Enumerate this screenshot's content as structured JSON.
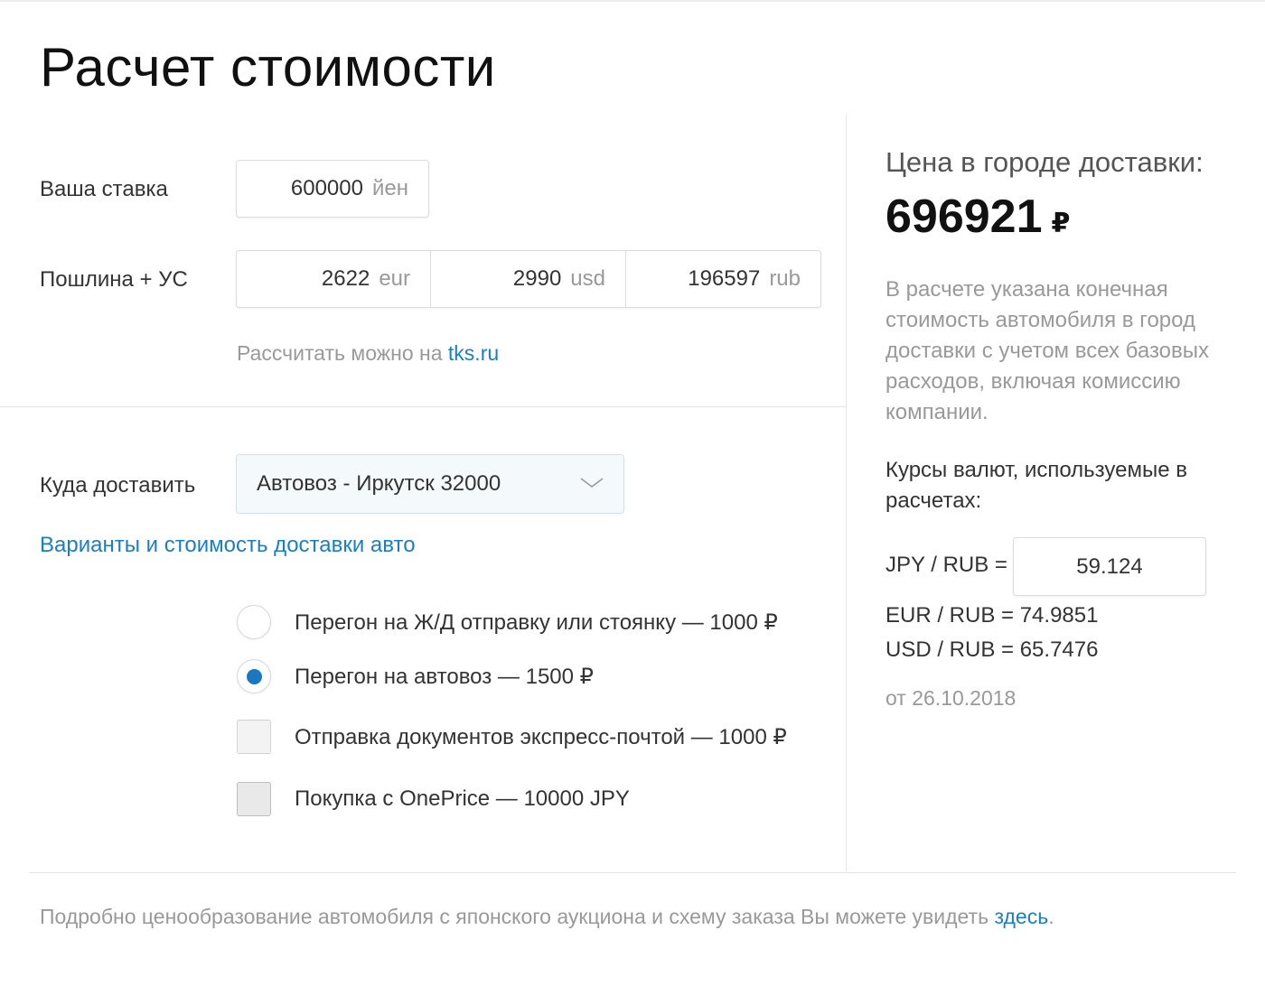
{
  "title": "Расчет стоимости",
  "bid": {
    "label": "Ваша ставка",
    "value": "600000",
    "unit": "йен"
  },
  "duty": {
    "label": "Пошлина + УС",
    "fields": [
      {
        "value": "2622",
        "unit": "eur"
      },
      {
        "value": "2990",
        "unit": "usd"
      },
      {
        "value": "196597",
        "unit": "rub"
      }
    ],
    "hint_text": "Рассчитать можно на",
    "hint_link": "tks.ru"
  },
  "delivery": {
    "label": "Куда доставить",
    "selected": "Автовоз - Иркутск 32000",
    "link": "Варианты и стоимость доставки авто"
  },
  "options": [
    {
      "type": "radio",
      "checked": false,
      "label": "Перегон на Ж/Д отправку или стоянку — 1000 ₽"
    },
    {
      "type": "radio",
      "checked": true,
      "label": "Перегон на автовоз — 1500 ₽"
    },
    {
      "type": "checkbox",
      "checked": false,
      "label": "Отправка документов экспресс-почтой — 1000 ₽"
    },
    {
      "type": "checkbox",
      "checked": false,
      "label": "Покупка с OnePrice — 10000 JPY"
    }
  ],
  "price": {
    "heading": "Цена в городе доставки:",
    "value": "696921",
    "currency": "₽",
    "description": "В расчете указана конечная стоимость автомобиля в город доставки с учетом всех базовых расходов, включая комиссию компании."
  },
  "rates": {
    "heading": "Курсы валют, используемые в расчетах:",
    "jpy_label": "JPY / RUB =",
    "jpy_value": "59.124",
    "eur": "EUR / RUB = 74.9851",
    "usd": "USD / RUB = 65.7476",
    "date": "от 26.10.2018"
  },
  "footer": {
    "text": "Подробно ценообразование автомобиля с японского аукциона и схему заказа Вы можете увидеть",
    "link": "здесь",
    "end": "."
  },
  "colors": {
    "accent": "#1a78c2",
    "link": "#1a7ec4",
    "muted": "#999999"
  }
}
